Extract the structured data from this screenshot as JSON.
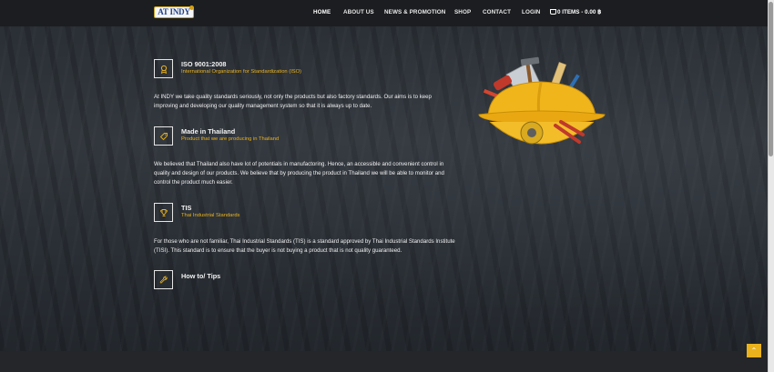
{
  "nav": {
    "logo_text": "AT INDY",
    "items": [
      {
        "label": "HOME"
      },
      {
        "label": "ABOUT US"
      },
      {
        "label": "NEWS & PROMOTION"
      },
      {
        "label": "SHOP"
      },
      {
        "label": "CONTACT"
      },
      {
        "label": "LOGIN"
      }
    ],
    "cart_label": "0 ITEMS - 0.00 ฿"
  },
  "features": [
    {
      "title": "ISO 9001:2008",
      "subtitle": "International Organization for Standardization (ISO)",
      "icon": "award-icon",
      "paragraph": "At INDY we take quality standards seriously, not only the products but also factory standards. Our aims is to keep improving and developing our quality management system so that it is always up to date."
    },
    {
      "title": "Made in Thailand",
      "subtitle": "Product that we are producing in Thailand",
      "icon": "tag-icon",
      "paragraph": "We believed that Thailand also have lot of potentials in manufactoring. Hence, an accessible and convenient control in quality and design of our products. We believe that by producing the product in Thailand we will be able to monitor and control the product much easier."
    },
    {
      "title": "TIS",
      "subtitle": "Thai Industrial Standards",
      "icon": "trophy-icon",
      "paragraph": "For those who are not familiar, Thai Industrial Standards (TIS) is a standard approved by Thai Industrial Standards Institute (TISI). This standard is to ensure that the buyer is not buying a product that is not quality guaranteed."
    },
    {
      "title": "How to/ Tips",
      "subtitle": "",
      "icon": "wrench-icon",
      "paragraph": ""
    }
  ],
  "image": {
    "icon": "hard-hat-tools-illustration"
  },
  "back_to_top": {
    "icon": "chevron-up-icon"
  },
  "colors": {
    "accent": "#eab21c",
    "nav_bg": "#1b1d20"
  }
}
